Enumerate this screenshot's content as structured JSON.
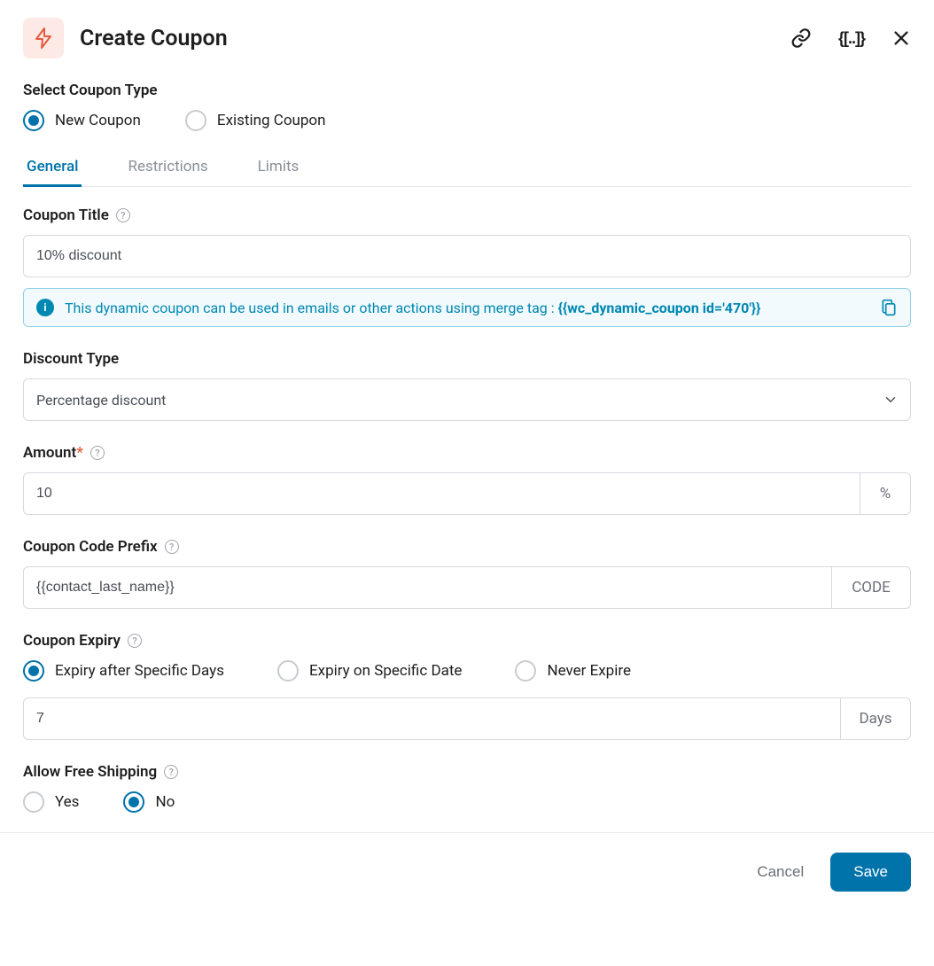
{
  "header": {
    "title": "Create Coupon"
  },
  "couponType": {
    "label": "Select Coupon Type",
    "options": [
      "New Coupon",
      "Existing Coupon"
    ],
    "selectedIndex": 0
  },
  "tabs": {
    "items": [
      "General",
      "Restrictions",
      "Limits"
    ],
    "activeIndex": 0
  },
  "couponTitle": {
    "label": "Coupon Title",
    "value": "10% discount"
  },
  "infoBox": {
    "prefix": "This dynamic coupon can be used in emails or other actions using merge tag : ",
    "tag": "{{wc_dynamic_coupon id='470'}}"
  },
  "discountType": {
    "label": "Discount Type",
    "value": "Percentage discount"
  },
  "amount": {
    "label": "Amount",
    "required": true,
    "value": "10",
    "suffix": "%"
  },
  "couponPrefix": {
    "label": "Coupon Code Prefix",
    "value": "{{contact_last_name}}",
    "suffix": "CODE"
  },
  "couponExpiry": {
    "label": "Coupon Expiry",
    "options": [
      "Expiry after Specific Days",
      "Expiry on Specific Date",
      "Never Expire"
    ],
    "selectedIndex": 0,
    "daysValue": "7",
    "daysSuffix": "Days"
  },
  "freeShipping": {
    "label": "Allow Free Shipping",
    "options": [
      "Yes",
      "No"
    ],
    "selectedIndex": 1
  },
  "footer": {
    "cancel": "Cancel",
    "save": "Save"
  }
}
